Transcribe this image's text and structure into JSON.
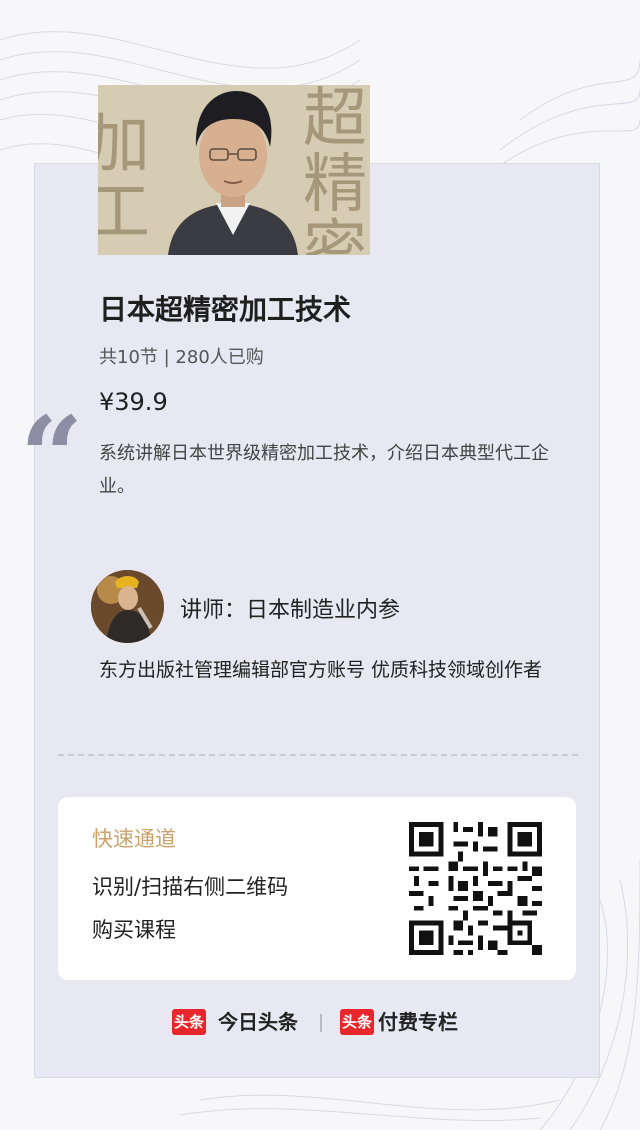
{
  "course": {
    "cover_chars": [
      "超",
      "精",
      "密",
      "加",
      "工"
    ],
    "title": "日本超精密加工技术",
    "meta": "共10节 | 280人已购",
    "price": "¥39.9",
    "quote_mark": "“",
    "description": "系统讲解日本世界级精密加工技术，介绍日本典型代工企业。"
  },
  "lecturer": {
    "label": "讲师：日本制造业内参",
    "bio": "东方出版社管理编辑部官方账号 优质科技领域创作者"
  },
  "quick_access": {
    "title": "快速通道",
    "line1": "识别/扫描右侧二维码",
    "line2": "购买课程",
    "qr_icon": "qr-code-icon"
  },
  "footer": {
    "badge1": "头条",
    "brand1": "今日头条",
    "badge2": "头条",
    "brand2": "付费专栏"
  },
  "colors": {
    "accent": "#c9a36b",
    "brand_red": "#e8262b"
  }
}
